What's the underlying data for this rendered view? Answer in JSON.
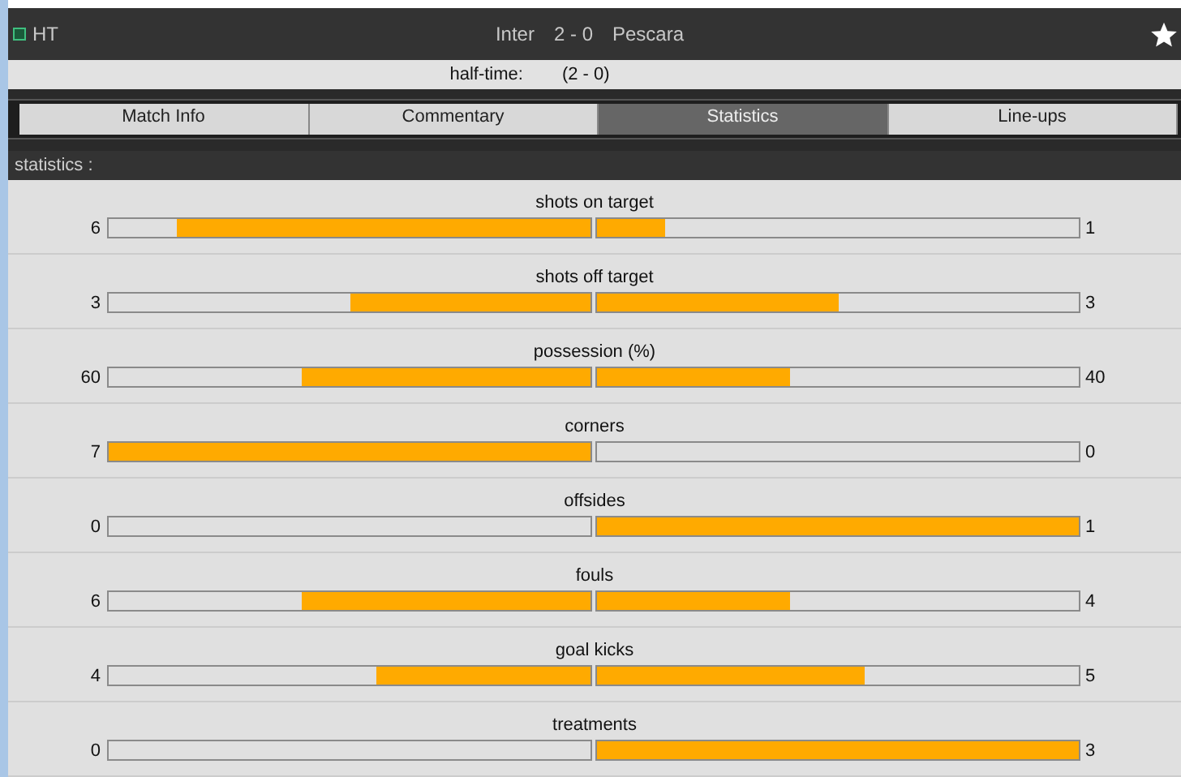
{
  "header": {
    "status": "HT",
    "home": "Inter",
    "score": "2 - 0",
    "away": "Pescara"
  },
  "half_time": {
    "label": "half-time:",
    "score": "(2 - 0)"
  },
  "tabs": [
    {
      "label": "Match Info",
      "selected": false
    },
    {
      "label": "Commentary",
      "selected": false
    },
    {
      "label": "Statistics",
      "selected": true
    },
    {
      "label": "Line-ups",
      "selected": false
    }
  ],
  "section_title": "statistics :",
  "stats": [
    {
      "name": "shots on target",
      "home": {
        "value": "6",
        "level": 0.857
      },
      "away": {
        "value": "1",
        "level": 0.143
      }
    },
    {
      "name": "shots off target",
      "home": {
        "value": "3",
        "level": 0.5
      },
      "away": {
        "value": "3",
        "level": 0.5
      }
    },
    {
      "name": "possession (%)",
      "home": {
        "value": "60",
        "level": 0.6
      },
      "away": {
        "value": "40",
        "level": 0.4
      }
    },
    {
      "name": "corners",
      "home": {
        "value": "7",
        "level": 1
      },
      "away": {
        "value": "0",
        "level": 0
      }
    },
    {
      "name": "offsides",
      "home": {
        "value": "0",
        "level": 0
      },
      "away": {
        "value": "1",
        "level": 1
      }
    },
    {
      "name": "fouls",
      "home": {
        "value": "6",
        "level": 0.6
      },
      "away": {
        "value": "4",
        "level": 0.4
      }
    },
    {
      "name": "goal kicks",
      "home": {
        "value": "4",
        "level": 0.444
      },
      "away": {
        "value": "5",
        "level": 0.556
      }
    },
    {
      "name": "treatments",
      "home": {
        "value": "0",
        "level": 0
      },
      "away": {
        "value": "3",
        "level": 1
      }
    }
  ]
}
